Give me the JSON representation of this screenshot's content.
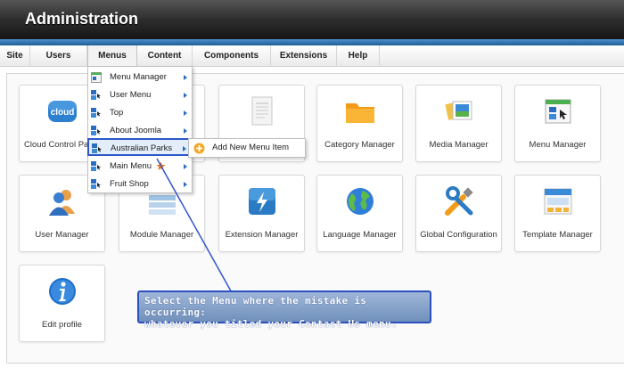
{
  "header": {
    "title": "Administration"
  },
  "menubar": {
    "items": [
      {
        "label": "Site"
      },
      {
        "label": "Users"
      },
      {
        "label": "Menus"
      },
      {
        "label": "Content"
      },
      {
        "label": "Components"
      },
      {
        "label": "Extensions"
      },
      {
        "label": "Help"
      }
    ],
    "active": "Menus"
  },
  "tiles": [
    {
      "label": "Cloud Control Panel",
      "icon": "cloud-icon",
      "logo_text": "cloud"
    },
    {
      "label": "",
      "icon": "folder-blue-icon"
    },
    {
      "label": "",
      "icon": "document-icon"
    },
    {
      "label": "Category Manager",
      "icon": "folder-icon"
    },
    {
      "label": "Media Manager",
      "icon": "media-icon"
    },
    {
      "label": "Menu Manager",
      "icon": "menu-manager-icon"
    },
    {
      "label": "User Manager",
      "icon": "users-icon"
    },
    {
      "label": "Module Manager",
      "icon": "modules-icon"
    },
    {
      "label": "Extension Manager",
      "icon": "extension-icon"
    },
    {
      "label": "Language Manager",
      "icon": "globe-icon"
    },
    {
      "label": "Global Configuration",
      "icon": "tools-icon"
    },
    {
      "label": "Template Manager",
      "icon": "template-icon"
    },
    {
      "label": "Edit profile",
      "icon": "info-icon"
    }
  ],
  "dropdown": {
    "items": [
      {
        "label": "Menu Manager",
        "icon": "menu-manager-icon",
        "submenu": true
      },
      {
        "label": "User Menu",
        "icon": "menu-icon",
        "submenu": true
      },
      {
        "label": "Top",
        "icon": "menu-icon",
        "submenu": true
      },
      {
        "label": "About Joomla",
        "icon": "menu-icon",
        "submenu": true
      },
      {
        "label": "Australian Parks",
        "icon": "menu-icon",
        "submenu": true,
        "highlighted": true
      },
      {
        "label": "Main Menu",
        "icon": "menu-icon",
        "submenu": true,
        "starred": true
      },
      {
        "label": "Fruit Shop",
        "icon": "menu-icon",
        "submenu": true
      }
    ],
    "submenu": {
      "label": "Add New Menu Item",
      "icon": "add-icon"
    }
  },
  "callout": {
    "line1": "Select the Menu where the mistake is occurring:",
    "line2": "whatever you titled your Contact Us menu."
  },
  "colors": {
    "header_stripe": "#2a72b8",
    "highlight_border": "#2d58c8",
    "callout_bg": "#7f9ccb",
    "annotation_line": "#3455d0"
  }
}
